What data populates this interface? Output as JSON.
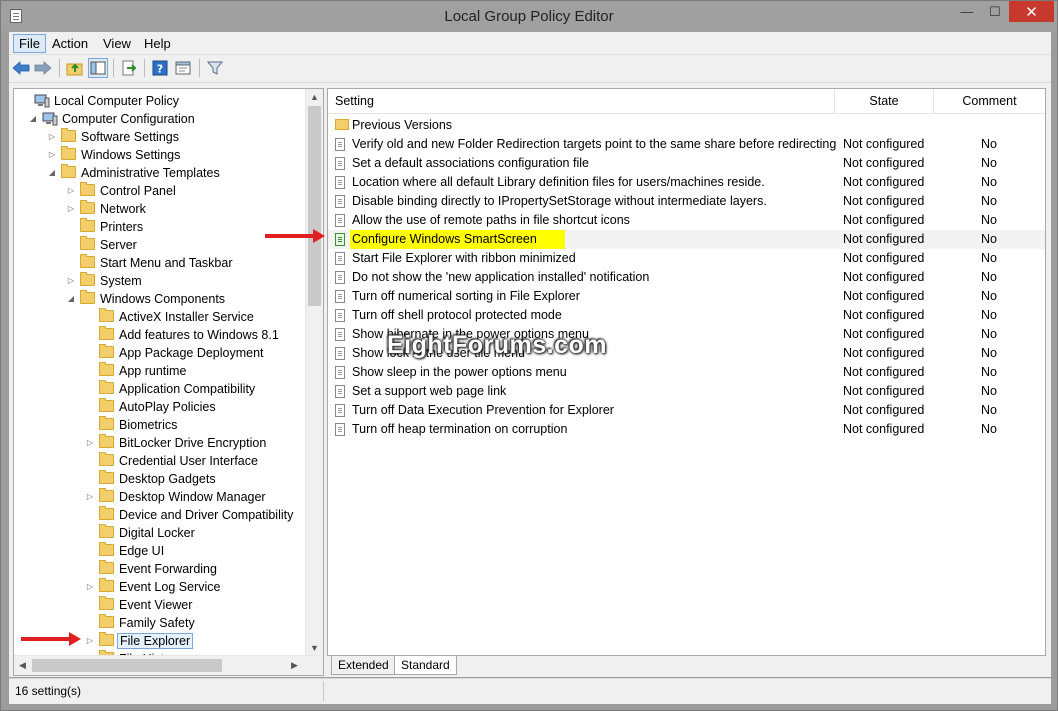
{
  "window": {
    "title": "Local Group Policy Editor",
    "min_glyph": "—",
    "max_glyph": "☐",
    "close_glyph": "✕"
  },
  "menu": [
    "File",
    "Action",
    "View",
    "Help"
  ],
  "toolbar": {
    "icons": [
      "back-arrow-icon",
      "forward-arrow-icon",
      "up-folder-icon",
      "show-hide-tree-icon",
      "export-list-icon",
      "help-icon",
      "properties-icon",
      "filter-icon"
    ]
  },
  "tree": [
    {
      "label": "Local Computer Policy",
      "indent": 0,
      "icon": "computer",
      "exp": ""
    },
    {
      "label": "Computer Configuration",
      "indent": 1,
      "icon": "computer",
      "exp": "open"
    },
    {
      "label": "Software Settings",
      "indent": 2,
      "icon": "folder",
      "exp": "closed"
    },
    {
      "label": "Windows Settings",
      "indent": 2,
      "icon": "folder",
      "exp": "closed"
    },
    {
      "label": "Administrative Templates",
      "indent": 2,
      "icon": "folder",
      "exp": "open"
    },
    {
      "label": "Control Panel",
      "indent": 3,
      "icon": "folder",
      "exp": "closed"
    },
    {
      "label": "Network",
      "indent": 3,
      "icon": "folder",
      "exp": "closed"
    },
    {
      "label": "Printers",
      "indent": 3,
      "icon": "folder",
      "exp": ""
    },
    {
      "label": "Server",
      "indent": 3,
      "icon": "folder",
      "exp": ""
    },
    {
      "label": "Start Menu and Taskbar",
      "indent": 3,
      "icon": "folder",
      "exp": ""
    },
    {
      "label": "System",
      "indent": 3,
      "icon": "folder",
      "exp": "closed"
    },
    {
      "label": "Windows Components",
      "indent": 3,
      "icon": "folder",
      "exp": "open"
    },
    {
      "label": "ActiveX Installer Service",
      "indent": 4,
      "icon": "folder",
      "exp": ""
    },
    {
      "label": "Add features to Windows 8.1",
      "indent": 4,
      "icon": "folder",
      "exp": ""
    },
    {
      "label": "App Package Deployment",
      "indent": 4,
      "icon": "folder",
      "exp": ""
    },
    {
      "label": "App runtime",
      "indent": 4,
      "icon": "folder",
      "exp": ""
    },
    {
      "label": "Application Compatibility",
      "indent": 4,
      "icon": "folder",
      "exp": ""
    },
    {
      "label": "AutoPlay Policies",
      "indent": 4,
      "icon": "folder",
      "exp": ""
    },
    {
      "label": "Biometrics",
      "indent": 4,
      "icon": "folder",
      "exp": ""
    },
    {
      "label": "BitLocker Drive Encryption",
      "indent": 4,
      "icon": "folder",
      "exp": "closed"
    },
    {
      "label": "Credential User Interface",
      "indent": 4,
      "icon": "folder",
      "exp": ""
    },
    {
      "label": "Desktop Gadgets",
      "indent": 4,
      "icon": "folder",
      "exp": ""
    },
    {
      "label": "Desktop Window Manager",
      "indent": 4,
      "icon": "folder",
      "exp": "closed"
    },
    {
      "label": "Device and Driver Compatibility",
      "indent": 4,
      "icon": "folder",
      "exp": ""
    },
    {
      "label": "Digital Locker",
      "indent": 4,
      "icon": "folder",
      "exp": ""
    },
    {
      "label": "Edge UI",
      "indent": 4,
      "icon": "folder",
      "exp": ""
    },
    {
      "label": "Event Forwarding",
      "indent": 4,
      "icon": "folder",
      "exp": ""
    },
    {
      "label": "Event Log Service",
      "indent": 4,
      "icon": "folder",
      "exp": "closed"
    },
    {
      "label": "Event Viewer",
      "indent": 4,
      "icon": "folder",
      "exp": ""
    },
    {
      "label": "Family Safety",
      "indent": 4,
      "icon": "folder",
      "exp": ""
    },
    {
      "label": "File Explorer",
      "indent": 4,
      "icon": "folder",
      "exp": "closed",
      "selected": true
    },
    {
      "label": "File History",
      "indent": 4,
      "icon": "folder",
      "exp": ""
    }
  ],
  "columns": {
    "setting": "Setting",
    "state": "State",
    "comment": "Comment"
  },
  "rows": [
    {
      "setting": "Previous Versions",
      "state": "",
      "comment": "",
      "type": "folder"
    },
    {
      "setting": "Verify old and new Folder Redirection targets point to the same share before redirecting",
      "state": "Not configured",
      "comment": "No",
      "type": "doc"
    },
    {
      "setting": "Set a default associations configuration file",
      "state": "Not configured",
      "comment": "No",
      "type": "doc"
    },
    {
      "setting": "Location where all default Library definition files for users/machines reside.",
      "state": "Not configured",
      "comment": "No",
      "type": "doc"
    },
    {
      "setting": "Disable binding directly to IPropertySetStorage without intermediate layers.",
      "state": "Not configured",
      "comment": "No",
      "type": "doc"
    },
    {
      "setting": "Allow the use of remote paths in file shortcut icons",
      "state": "Not configured",
      "comment": "No",
      "type": "doc"
    },
    {
      "setting": "Configure Windows SmartScreen",
      "state": "Not configured",
      "comment": "No",
      "type": "doc-green",
      "highlight": true
    },
    {
      "setting": "Start File Explorer with ribbon minimized",
      "state": "Not configured",
      "comment": "No",
      "type": "doc"
    },
    {
      "setting": "Do not show the 'new application installed' notification",
      "state": "Not configured",
      "comment": "No",
      "type": "doc"
    },
    {
      "setting": "Turn off numerical sorting in File Explorer",
      "state": "Not configured",
      "comment": "No",
      "type": "doc"
    },
    {
      "setting": "Turn off shell protocol protected mode",
      "state": "Not configured",
      "comment": "No",
      "type": "doc"
    },
    {
      "setting": "Show hibernate in the power options menu",
      "state": "Not configured",
      "comment": "No",
      "type": "doc"
    },
    {
      "setting": "Show lock in the user tile menu",
      "state": "Not configured",
      "comment": "No",
      "type": "doc"
    },
    {
      "setting": "Show sleep in the power options menu",
      "state": "Not configured",
      "comment": "No",
      "type": "doc"
    },
    {
      "setting": "Set a support web page link",
      "state": "Not configured",
      "comment": "No",
      "type": "doc"
    },
    {
      "setting": "Turn off Data Execution Prevention for Explorer",
      "state": "Not configured",
      "comment": "No",
      "type": "doc"
    },
    {
      "setting": "Turn off heap termination on corruption",
      "state": "Not configured",
      "comment": "No",
      "type": "doc"
    }
  ],
  "tabs": [
    "Extended",
    "Standard"
  ],
  "status": {
    "text": "16 setting(s)"
  },
  "watermark": "EightForums.com",
  "colors": {
    "highlight": "#ffff00",
    "arrow": "#e02020",
    "close": "#c7392c"
  }
}
